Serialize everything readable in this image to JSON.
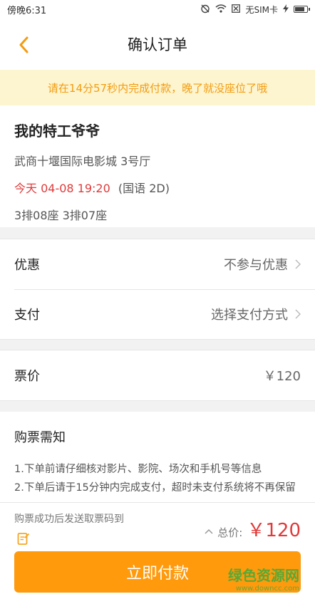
{
  "status_bar": {
    "time": "傍晚6:31",
    "carrier": "无SIM卡",
    "icons": [
      "alarm-off-icon",
      "wifi-icon",
      "no-sim-icon",
      "charging-icon",
      "battery-icon"
    ]
  },
  "header": {
    "back_icon": "chevron-left-icon",
    "title": "确认订单"
  },
  "notice": {
    "text": "请在14分57秒内完成付款，晚了就没座位了哦"
  },
  "movie": {
    "title": "我的特工爷爷",
    "cinema": "武商十堰国际电影城 3号厅",
    "showtime": "今天 04-08 19:20",
    "language": "(国语 2D)",
    "seats": "3排08座 3排07座"
  },
  "options": {
    "discount_label": "优惠",
    "discount_value": "不参与优惠",
    "payment_label": "支付",
    "payment_value": "选择支付方式"
  },
  "price": {
    "label": "票价",
    "value": "￥120"
  },
  "notes": {
    "title": "购票需知",
    "lines": [
      "1.下单前请仔细核对影片、影院、场次和手机号等信息",
      "2.下单后请于15分钟内完成支付，超时未支付系统将不再保留"
    ]
  },
  "bottom": {
    "sms_text": "购票成功后发送取票码到",
    "sms_icon": "edit-note-icon",
    "total_label": "总价:",
    "total_amount": "￥120",
    "pay_button": "立即付款"
  },
  "watermark": {
    "line1": "绿色资源网",
    "line2": "www.downcc.com"
  },
  "colors": {
    "accent": "#ff9a0d",
    "price_red": "#e03a3a",
    "notice_bg": "#fdf5cf",
    "notice_text": "#f39c12"
  }
}
